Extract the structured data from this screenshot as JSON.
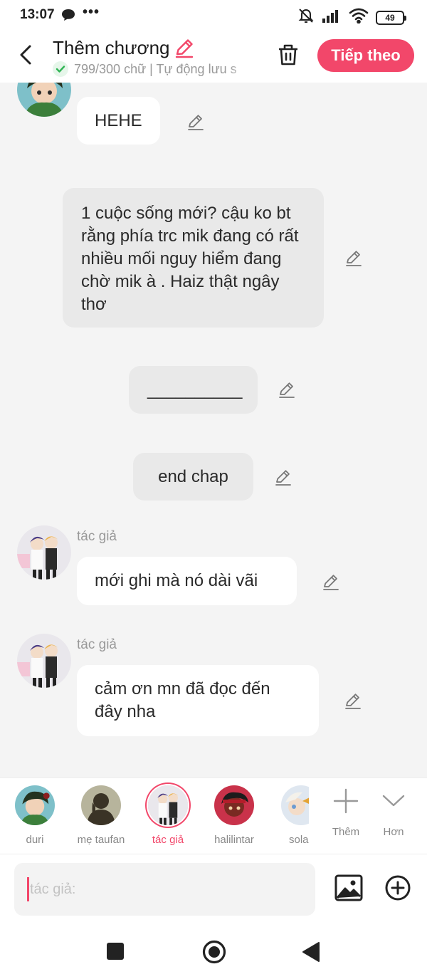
{
  "status": {
    "time": "13:07",
    "battery": "49"
  },
  "header": {
    "title": "Thêm chương",
    "subtitle": "799/300 chữ | Tự động lưu s",
    "next_label": "Tiếp theo"
  },
  "messages": [
    {
      "text": "HEHE"
    },
    {
      "text": "1 cuộc sống mới? cậu ko bt rằng phía trc mik đang có rất nhiều mối nguy hiểm đang chờ mik à . Haiz thật ngây thơ"
    },
    {
      "text": "__________"
    },
    {
      "text": "end chap"
    },
    {
      "author": "tác giả",
      "text": "mới ghi mà nó dài vãi"
    },
    {
      "author": "tác giả",
      "text": "cảm ơn mn đã đọc đến đây nha"
    }
  ],
  "characters": [
    {
      "name": "duri"
    },
    {
      "name": "mẹ taufan"
    },
    {
      "name": "tác giả"
    },
    {
      "name": "halilintar"
    },
    {
      "name": "solar"
    }
  ],
  "actions": {
    "add_label": "Thêm",
    "more_label": "Hơn"
  },
  "input": {
    "placeholder": "tác giả:"
  },
  "colors": {
    "accent": "#f2476a",
    "background": "#f4f4f4",
    "bubble_white": "#ffffff",
    "bubble_grey": "#e9e9e9"
  }
}
